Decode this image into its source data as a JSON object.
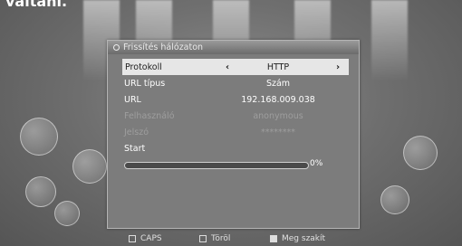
{
  "top_text": "váltani.",
  "dialog": {
    "title": "Frissítés hálózaton",
    "rows": [
      {
        "label": "Protokoll",
        "value": "HTTP",
        "left_arrow": "‹",
        "right_arrow": "›"
      },
      {
        "label": "URL típus",
        "value": "Szám"
      },
      {
        "label": "URL",
        "value": "192.168.009.038"
      },
      {
        "label": "Felhasználó",
        "value": "anonymous"
      },
      {
        "label": "Jelszó",
        "value": "********"
      },
      {
        "label": "Start"
      }
    ],
    "progress": {
      "percent": 0,
      "text": "0%"
    }
  },
  "footer": {
    "items": [
      {
        "label": "CAPS"
      },
      {
        "label": "Töröl"
      },
      {
        "label": "Meg szakít"
      }
    ]
  }
}
